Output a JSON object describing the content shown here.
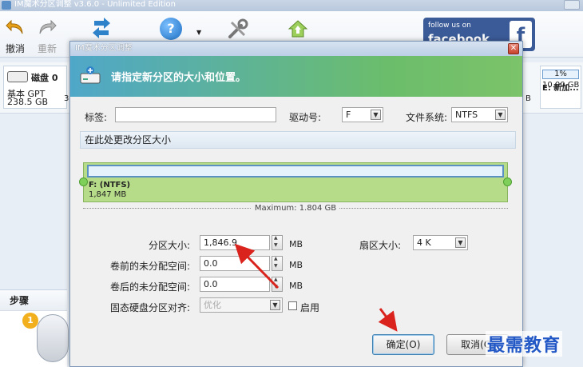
{
  "app": {
    "title": "IM魔术分区调整 v3.6.0 - Unlimited Edition",
    "toolbar": {
      "undo_label": "撤消",
      "redo_label": "重新",
      "facebook_small": "follow us on",
      "facebook_big": "facebook",
      "facebook_letter": "f"
    },
    "disk": {
      "name": "磁盘 0",
      "type": "基本 GPT",
      "size": "238.5 GB"
    },
    "partition_e": {
      "percent": "1%",
      "label": "E: 新加...",
      "size": "10.00 GB"
    },
    "peek_left": "3",
    "peek_right": "B",
    "steps": {
      "title": "步骤",
      "number": "1"
    },
    "icons": {
      "undo": "undo-icon",
      "redo": "redo-icon",
      "arrows": "partition-arrows-icon",
      "help": "help-icon",
      "tools": "tools-icon",
      "home": "home-upload-icon"
    }
  },
  "dialog": {
    "title": "IM魔术分区调整",
    "header_message": "请指定新分区的大小和位置。",
    "label_field": {
      "label": "标签:",
      "value": ""
    },
    "drive_letter": {
      "label": "驱动号:",
      "value": "F"
    },
    "file_system": {
      "label": "文件系统:",
      "value": "NTFS"
    },
    "resize_section_title": "在此处更改分区大小",
    "partition": {
      "name": "F: (NTFS)",
      "size": "1,847 MB",
      "fill_fraction": 1.0
    },
    "maximum_label": "Maximum: 1.804 GB",
    "partition_size": {
      "label": "分区大小:",
      "value": "1,846.9",
      "unit": "MB"
    },
    "unallocated_before": {
      "label": "卷前的未分配空间:",
      "value": "0.0",
      "unit": "MB"
    },
    "unallocated_after": {
      "label": "卷后的未分配空间:",
      "value": "0.0",
      "unit": "MB"
    },
    "cluster_size": {
      "label": "扇区大小:",
      "value": "4 K"
    },
    "ssd_align": {
      "label": "固态硬盘分区对齐:",
      "value": "优化",
      "enable_label": "启用",
      "checked": false
    },
    "ok_label": "确定(O)",
    "cancel_label": "取消(C)"
  },
  "watermark": "最需教育",
  "colors": {
    "header_gradient_start": "#4fa7c9",
    "header_gradient_end": "#7cc36a",
    "partition_fill": "#b7dc89",
    "arrow_red": "#d9231c",
    "watermark_blue": "#2257c6"
  }
}
